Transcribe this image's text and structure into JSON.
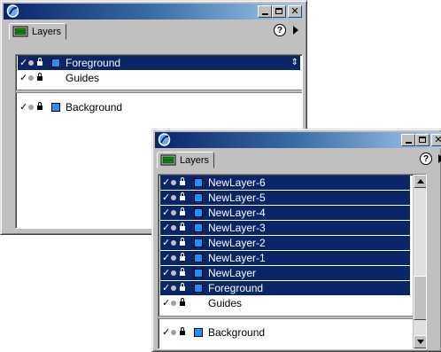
{
  "window_back": {
    "tab_label": "Layers",
    "help_label": "?",
    "upper_layers": [
      {
        "name": "Foreground",
        "selected": true
      },
      {
        "name": "Guides",
        "selected": false,
        "no_swatch": true
      }
    ],
    "lower_layers": [
      {
        "name": "Background",
        "selected": false
      }
    ]
  },
  "window_front": {
    "tab_label": "Layers",
    "help_label": "?",
    "upper_layers": [
      {
        "name": "NewLayer-6",
        "selected": true
      },
      {
        "name": "NewLayer-5",
        "selected": true
      },
      {
        "name": "NewLayer-4",
        "selected": true
      },
      {
        "name": "NewLayer-3",
        "selected": true
      },
      {
        "name": "NewLayer-2",
        "selected": true
      },
      {
        "name": "NewLayer-1",
        "selected": true
      },
      {
        "name": "NewLayer",
        "selected": true
      },
      {
        "name": "Foreground",
        "selected": true
      },
      {
        "name": "Guides",
        "selected": false,
        "no_swatch": true
      }
    ],
    "lower_layers": [
      {
        "name": "Background",
        "selected": false
      }
    ],
    "scroll_position": 0.85
  },
  "colors": {
    "selection": "#0a246a",
    "layer_swatch": "#1e90ff",
    "face": "#c0c0c0"
  },
  "icons": {
    "app": "app-logo-icon",
    "visibility": "checkmark-icon",
    "dot": "dot-icon",
    "lock": "lock-icon",
    "minimize": "minimize-icon",
    "maximize": "maximize-icon",
    "close": "close-icon"
  }
}
